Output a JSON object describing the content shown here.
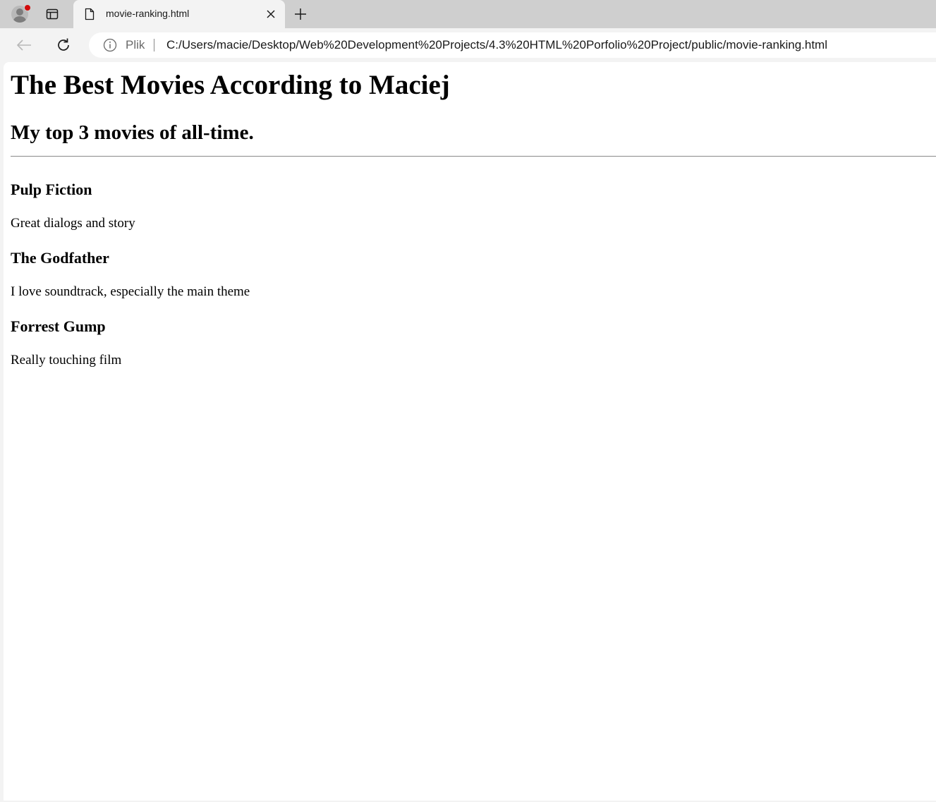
{
  "browser": {
    "tab": {
      "title": "movie-ranking.html"
    },
    "omnibox": {
      "site_label": "Plik",
      "url": "C:/Users/macie/Desktop/Web%20Development%20Projects/4.3%20HTML%20Porfolio%20Project/public/movie-ranking.html"
    }
  },
  "page": {
    "title": "The Best Movies According to Maciej",
    "subtitle": "My top 3 movies of all-time.",
    "movies": [
      {
        "title": "Pulp Fiction",
        "description": "Great dialogs and story"
      },
      {
        "title": "The Godfather",
        "description": "I love soundtrack, especially the main theme"
      },
      {
        "title": "Forrest Gump",
        "description": "Really touching film"
      }
    ]
  },
  "colors": {
    "tabstrip_bg": "#cfcfcf",
    "toolbar_bg": "#f3f3f3",
    "page_bg": "#ffffff",
    "profile_notification": "#d20a0a"
  },
  "icons": {
    "profile": "profile-icon",
    "tab_actions": "tab-actions-icon",
    "page": "page-icon",
    "close": "close-icon",
    "new_tab": "plus-icon",
    "back": "back-arrow-icon",
    "refresh": "refresh-icon",
    "info": "info-icon"
  }
}
